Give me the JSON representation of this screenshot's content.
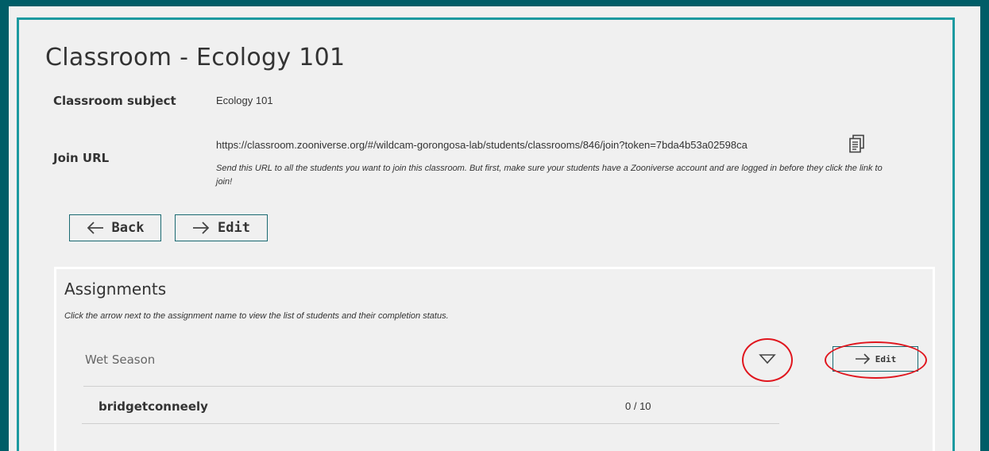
{
  "page": {
    "title": "Classroom - Ecology 101"
  },
  "details": {
    "subject_label": "Classroom subject",
    "subject_value": "Ecology 101",
    "join_label": "Join URL",
    "join_url": "https://classroom.zooniverse.org/#/wildcam-gorongosa-lab/students/classrooms/846/join?token=7bda4b53a02598ca",
    "join_note_line1": "Send this URL to all the students you want to join this classroom. But first, make sure your students have a Zooniverse account and are logged in before they click the link to",
    "join_note_line2": "join!",
    "copy_icon": "clipboard-copy-icon"
  },
  "actions": {
    "back_label": "Back",
    "edit_label": "Edit"
  },
  "assignments": {
    "title": "Assignments",
    "instruction": "Click the arrow next to the assignment name to view the list of students and their completion status.",
    "items": [
      {
        "name": "Wet Season",
        "edit_label": "Edit",
        "students": [
          {
            "name": "bridgetconneely",
            "progress": "0 / 10"
          }
        ]
      }
    ]
  },
  "colors": {
    "background": "#005d67",
    "panel": "#f0f0f0",
    "frame_border": "#1c9aa0",
    "highlight_ring": "#e0161e"
  }
}
